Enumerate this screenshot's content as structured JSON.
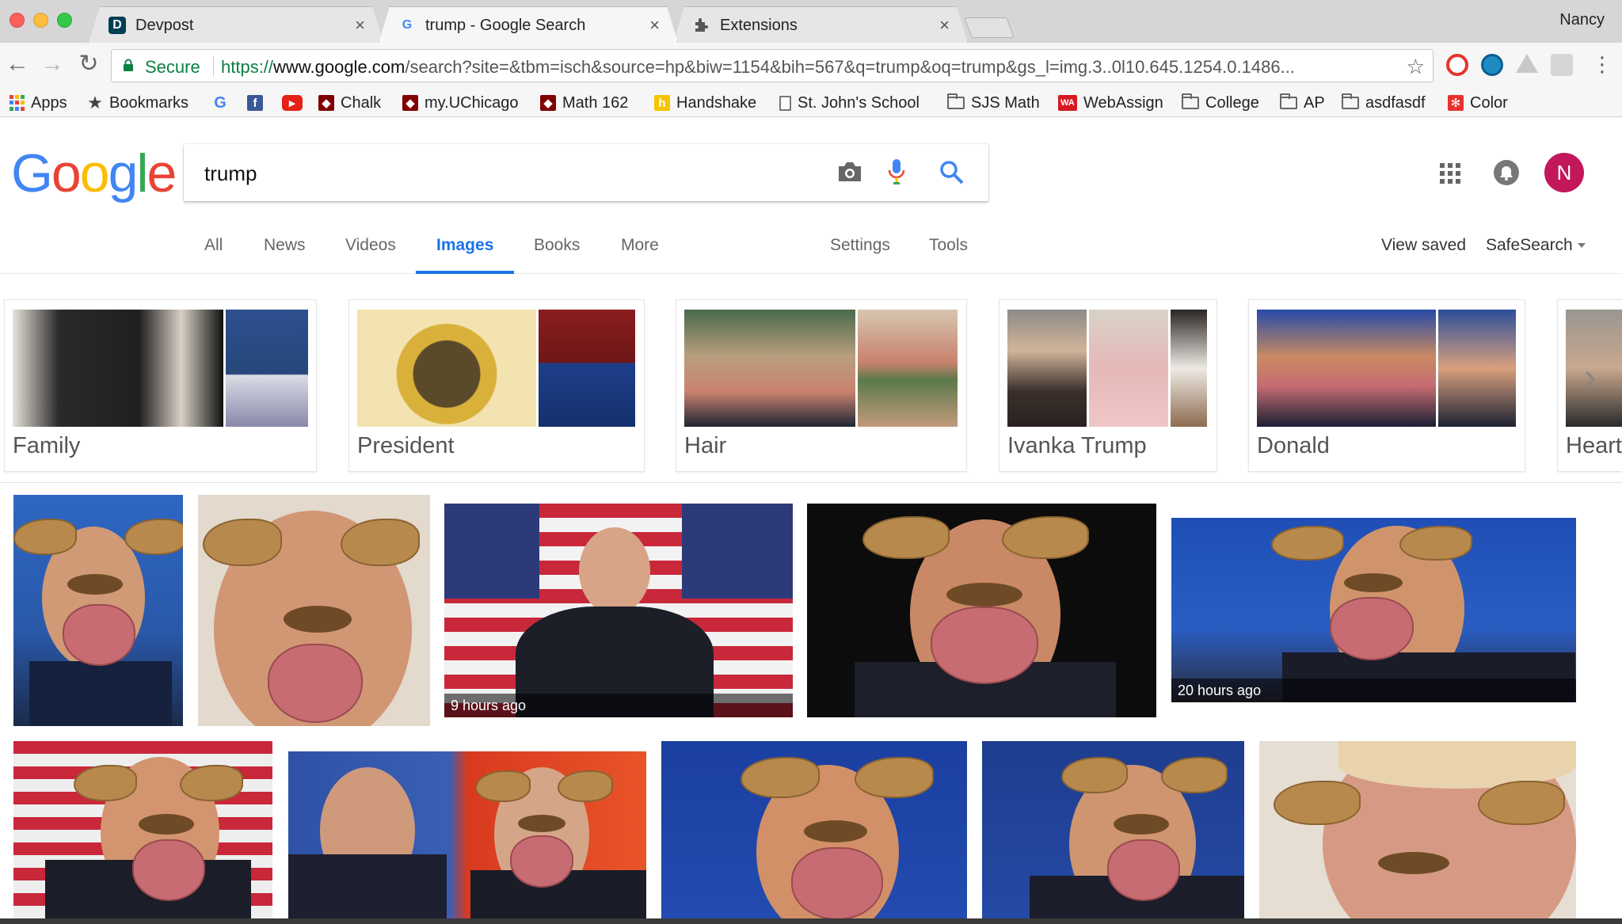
{
  "browser": {
    "tabs": [
      {
        "title": "Devpost",
        "favicon": "D"
      },
      {
        "title": "trump - Google Search",
        "favicon": "G"
      },
      {
        "title": "Extensions",
        "favicon": "puzzle-icon"
      }
    ],
    "close_glyph": "×",
    "user": "Nancy",
    "omnibox": {
      "secure_label": "Secure",
      "scheme": "https://",
      "host": "www.google.com",
      "path": "/search?site=&tbm=isch&source=hp&biw=1154&bih=567&q=trump&oq=trump&gs_l=img.3..0l10.645.1254.0.1486...",
      "star": "☆"
    },
    "nav": {
      "back": "←",
      "forward": "→",
      "reload": "↻"
    },
    "menu": "⋮"
  },
  "bookmarks": [
    {
      "label": "Apps",
      "icon": "apps-icon"
    },
    {
      "label": "Bookmarks",
      "icon": "star-icon"
    },
    {
      "label": "",
      "icon": "google-icon"
    },
    {
      "label": "",
      "icon": "facebook-icon"
    },
    {
      "label": "",
      "icon": "youtube-icon"
    },
    {
      "label": "Chalk",
      "icon": "uchicago-icon"
    },
    {
      "label": "my.UChicago",
      "icon": "uchicago-icon"
    },
    {
      "label": "Math 162",
      "icon": "uchicago-icon"
    },
    {
      "label": "Handshake",
      "icon": "handshake-icon"
    },
    {
      "label": "St. John's School",
      "icon": "page-icon"
    },
    {
      "label": "SJS Math",
      "icon": "folder-icon"
    },
    {
      "label": "WebAssign",
      "icon": "webassign-icon"
    },
    {
      "label": "College",
      "icon": "folder-icon"
    },
    {
      "label": "AP",
      "icon": "folder-icon"
    },
    {
      "label": "asdfasdf",
      "icon": "folder-icon"
    },
    {
      "label": "Color",
      "icon": "color-icon"
    }
  ],
  "google": {
    "logo": [
      "G",
      "o",
      "o",
      "g",
      "l",
      "e"
    ],
    "logo_colors": [
      "#4285F4",
      "#EA4335",
      "#FBBC05",
      "#4285F4",
      "#34A853",
      "#EA4335"
    ],
    "query": "trump",
    "avatar_letter": "N"
  },
  "tabs": {
    "all": "All",
    "news": "News",
    "videos": "Videos",
    "images": "Images",
    "books": "Books",
    "more": "More",
    "settings": "Settings",
    "tools": "Tools",
    "view_saved": "View saved",
    "safesearch": "SafeSearch"
  },
  "related": [
    {
      "label": "Family"
    },
    {
      "label": "President"
    },
    {
      "label": "Hair"
    },
    {
      "label": "Ivanka Trump"
    },
    {
      "label": "Donald"
    },
    {
      "label": "Heart"
    }
  ],
  "chip_arrow": "›",
  "results": {
    "ts1": "9 hours ago",
    "ts2": "20 hours ago"
  },
  "colors": {
    "accent": "#1a73e8",
    "secure_green": "#0b8043",
    "avatar": "#c2185b"
  }
}
